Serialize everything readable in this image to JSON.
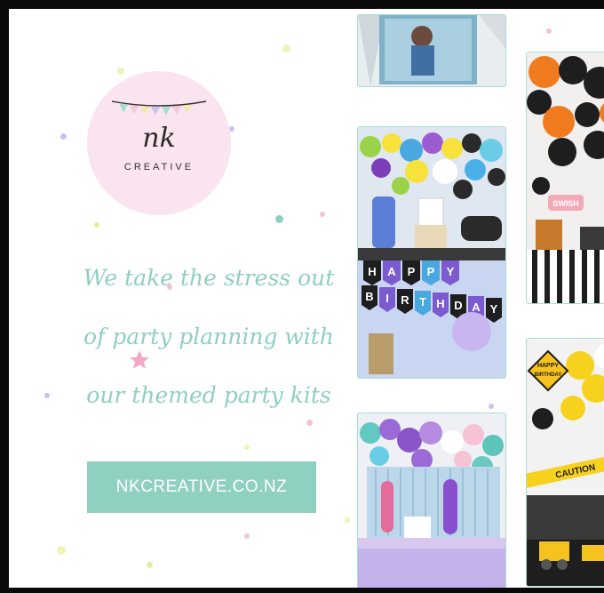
{
  "logo": {
    "monogram": "nk",
    "wordmark": "CREATIVE"
  },
  "tagline": [
    "We take the stress out",
    "of party planning with",
    "our themed party kits"
  ],
  "cta": {
    "label": "NKCREATIVE.CO.NZ"
  },
  "photos": {
    "birthday_banner_letters": [
      "H",
      "A",
      "P",
      "P",
      "Y",
      "B",
      "I",
      "R",
      "T",
      "H",
      "D",
      "A",
      "Y"
    ],
    "cake_topper": "SWISH",
    "construction_sign_top": "HAPPY",
    "construction_sign_bottom": "BIRTHDAY",
    "caution_tape": "CAUTION"
  },
  "colors": {
    "teal": "#8fd0c0",
    "pink": "#f9e4ef",
    "border": "#0a0a0a"
  }
}
